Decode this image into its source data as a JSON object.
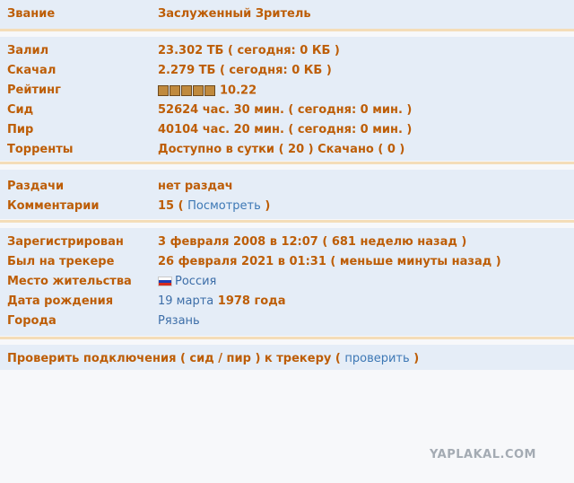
{
  "rank": {
    "label": "Звание",
    "value": "Заслуженный Зритель"
  },
  "stats": {
    "uploaded": {
      "label": "Залил",
      "value": "23.302 ТБ ( сегодня: 0 КБ )"
    },
    "downloaded": {
      "label": "Скачал",
      "value": "2.279 ТБ ( сегодня: 0 КБ )"
    },
    "rating": {
      "label": "Рейтинг",
      "value": "10.22",
      "stars": 5
    },
    "seed": {
      "label": "Сид",
      "value": "52624 час. 30 мин. ( сегодня: 0 мин. )"
    },
    "peer": {
      "label": "Пир",
      "value": "40104 час. 20 мин. ( сегодня: 0 мин. )"
    },
    "torrents": {
      "label": "Торренты",
      "value": "Доступно в сутки ( 20 ) Скачано ( 0 )"
    }
  },
  "activity": {
    "releases": {
      "label": "Раздачи",
      "value": "нет раздач"
    },
    "comments": {
      "label": "Комментарии",
      "count": "15 (",
      "link": "Посмотреть",
      "close": " )"
    }
  },
  "profile": {
    "registered": {
      "label": "Зарегистрирован",
      "value": "3 февраля 2008 в 12:07 ( 681 неделю назад )"
    },
    "last_seen": {
      "label": "Был на трекере",
      "value": "26 февраля 2021 в 01:31 ( меньше минуты назад )"
    },
    "location": {
      "label": "Место жительства",
      "value": "Россия",
      "flag": "russia-flag-icon"
    },
    "birthday": {
      "label": "Дата рождения",
      "day": "19 марта",
      "year": "1978 года"
    },
    "cities": {
      "label": "Города",
      "value": "Рязань"
    }
  },
  "connection": {
    "text": "Проверить подключения ( сид / пир ) к трекеру (",
    "link": "проверить",
    "close": " )"
  },
  "watermark": "YAPLAKAL.COM",
  "colors": {
    "label": "#bd5d06",
    "link": "#3d78b5",
    "section_bg": "#e5edf7",
    "divider": "#f4ddb8"
  }
}
